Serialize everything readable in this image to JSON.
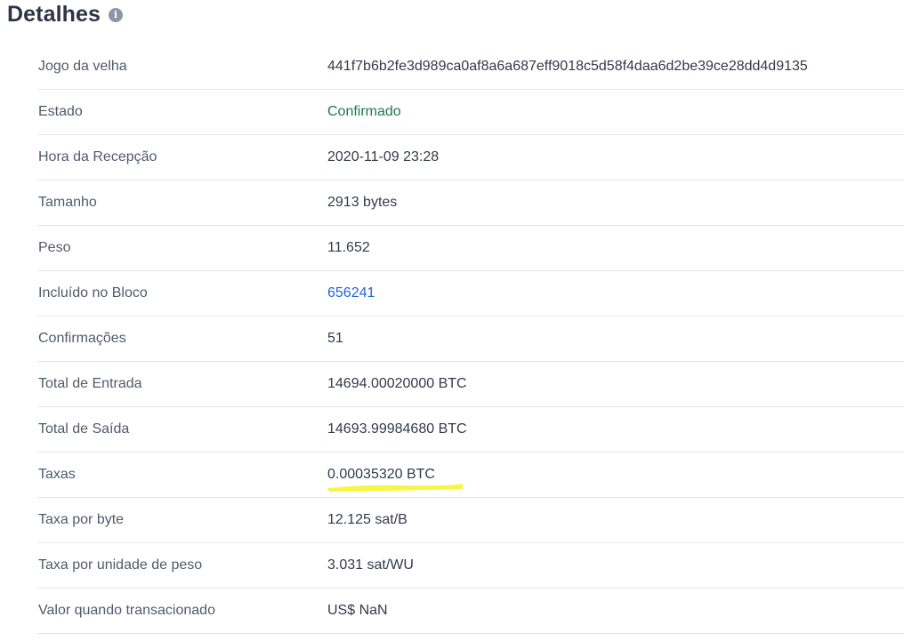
{
  "section": {
    "title": "Detalhes",
    "info_icon": "info-icon"
  },
  "details": [
    {
      "label": "Jogo da velha",
      "value": "441f7b6b2fe3d989ca0af8a6a687eff9018c5d58f4daa6d2be39ce28dd4d9135"
    },
    {
      "label": "Estado",
      "value": "Confirmado"
    },
    {
      "label": "Hora da Recepção",
      "value": "2020-11-09 23:28"
    },
    {
      "label": "Tamanho",
      "value": "2913 bytes"
    },
    {
      "label": "Peso",
      "value": "11.652"
    },
    {
      "label": "Incluído no Bloco",
      "value": "656241"
    },
    {
      "label": "Confirmações",
      "value": "51"
    },
    {
      "label": "Total de Entrada",
      "value": "14694.00020000 BTC"
    },
    {
      "label": "Total de Saída",
      "value": "14693.99984680 BTC"
    },
    {
      "label": "Taxas",
      "value": "0.00035320 BTC"
    },
    {
      "label": "Taxa por byte",
      "value": "12.125 sat/B"
    },
    {
      "label": "Taxa por unidade de peso",
      "value": "3.031 sat/WU"
    },
    {
      "label": "Valor quando transacionado",
      "value": "US$ NaN"
    }
  ],
  "colors": {
    "confirmed_status": "#1e7a4c",
    "block_link": "#2365d6",
    "highlighter": "#f7f53b"
  }
}
